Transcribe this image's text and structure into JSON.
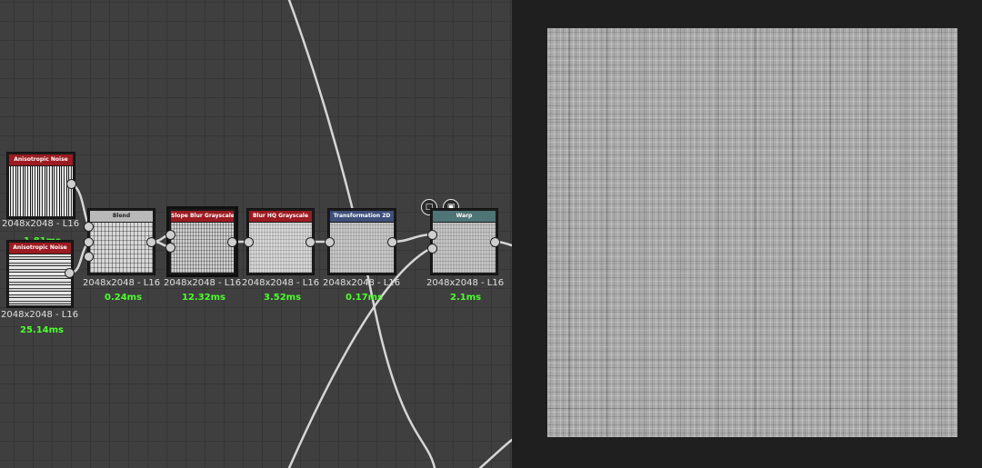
{
  "nodes": [
    {
      "id": "aniso1",
      "title": "Anisotropic Noise",
      "header_color": "#9c1b22",
      "resolution": "2048x2048 - L16",
      "time": "1.81ms"
    },
    {
      "id": "aniso2",
      "title": "Anisotropic Noise",
      "header_color": "#9c1b22",
      "resolution": "2048x2048 - L16",
      "time": "25.14ms"
    },
    {
      "id": "blend",
      "title": "Blend",
      "header_color": "#b9b9b9",
      "resolution": "2048x2048 - L16",
      "time": "0.24ms"
    },
    {
      "id": "slope",
      "title": "Slope Blur Grayscale",
      "header_color": "#9c1b22",
      "resolution": "2048x2048 - L16",
      "time": "12.32ms"
    },
    {
      "id": "blurhq",
      "title": "Blur HQ Grayscale",
      "header_color": "#9c1b22",
      "resolution": "2048x2048 - L16",
      "time": "3.52ms"
    },
    {
      "id": "transform",
      "title": "Transformation 2D",
      "header_color": "#3e4f7a",
      "resolution": "2048x2048 - L16",
      "time": "0.17ms"
    },
    {
      "id": "warp",
      "title": "Warp",
      "header_color": "#4e7476",
      "resolution": "2048x2048 - L16",
      "time": "2.1ms"
    }
  ],
  "toolbar_icons": [
    "document-icon",
    "checker-icon"
  ],
  "colors": {
    "graph_bg": "#3f3f3f",
    "wire": "#d9d9d9",
    "time_text": "#4cff2d",
    "viewer_bg": "#1f1f1f"
  }
}
